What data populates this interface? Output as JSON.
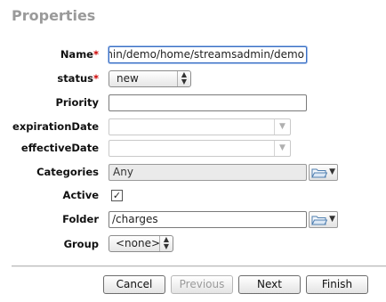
{
  "panel": {
    "title": "Properties"
  },
  "fields": {
    "name": {
      "label": "Name",
      "required_mark": "*",
      "value": "sadmin/demo/home/streamsadmin/demo"
    },
    "status": {
      "label": "status",
      "required_mark": "*",
      "value": "new"
    },
    "priority": {
      "label": "Priority",
      "value": ""
    },
    "expiration_date": {
      "label": "expirationDate",
      "value": ""
    },
    "effective_date": {
      "label": "effectiveDate",
      "value": ""
    },
    "categories": {
      "label": "Categories",
      "value": "Any",
      "icon": "folder-icon"
    },
    "active": {
      "label": "Active",
      "checked": true,
      "check_glyph": "✓"
    },
    "folder": {
      "label": "Folder",
      "value": "/charges",
      "icon": "folder-icon"
    },
    "group": {
      "label": "Group",
      "value": "<none>"
    }
  },
  "buttons": {
    "cancel": "Cancel",
    "previous": "Previous",
    "next": "Next",
    "finish": "Finish"
  }
}
